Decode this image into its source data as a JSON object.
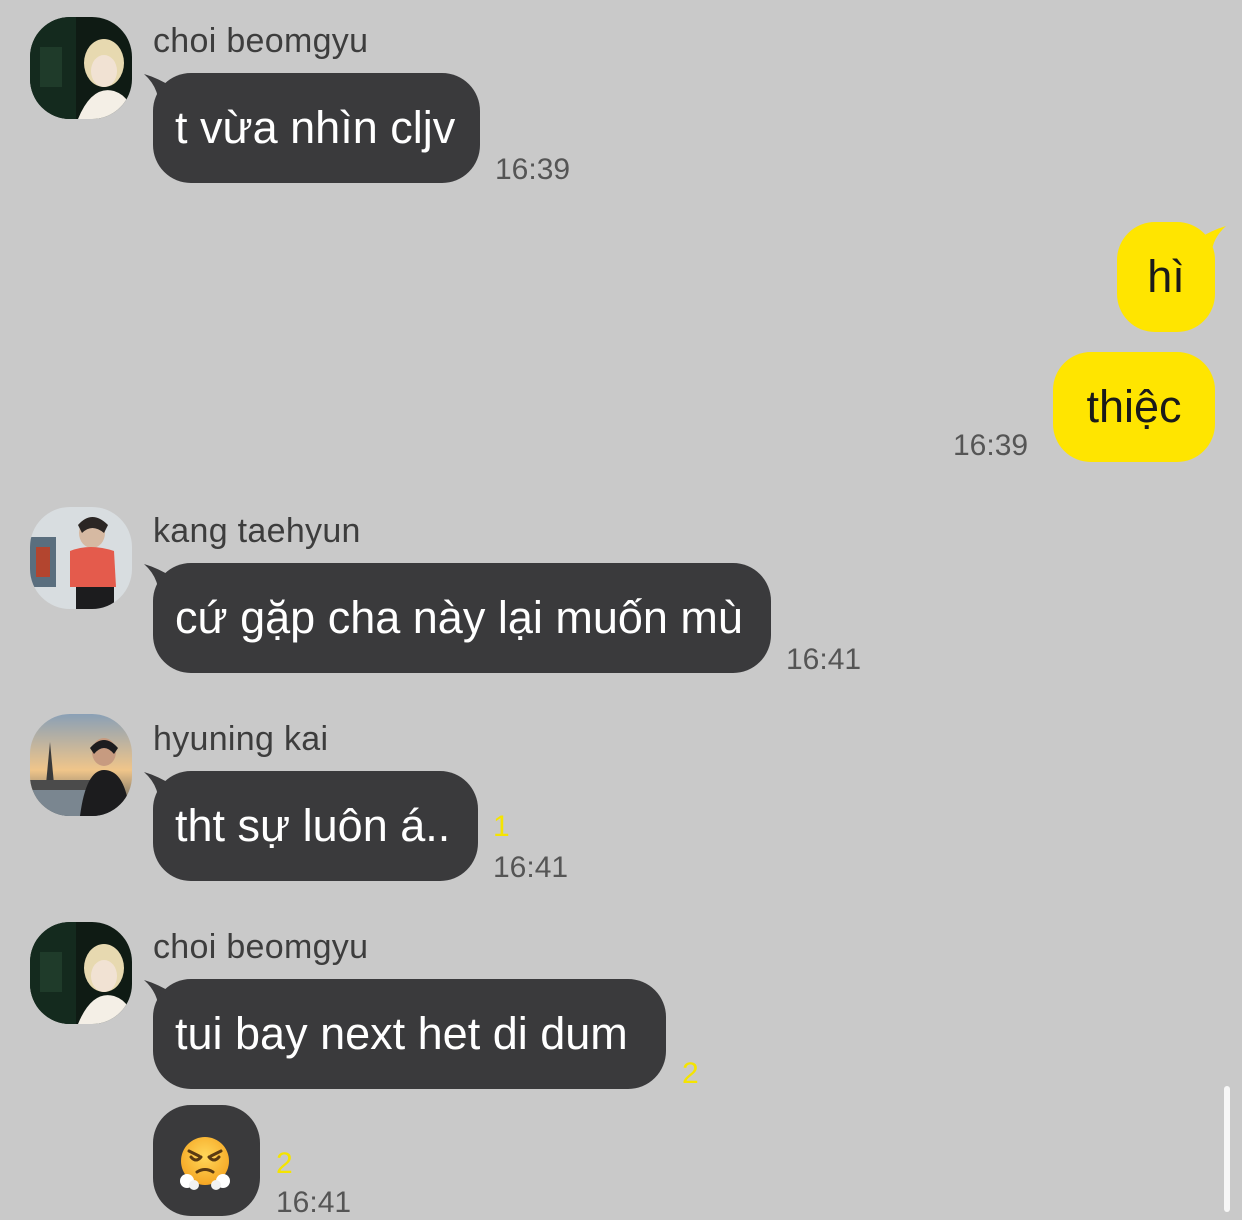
{
  "messages": [
    {
      "sender": "choi beomgyu",
      "text": "t vừa nhìn cljv",
      "time": "16:39"
    },
    {
      "text": "hì"
    },
    {
      "text": "thiệc",
      "time": "16:39"
    },
    {
      "sender": "kang taehyun",
      "text": "cứ gặp cha này lại muốn mù",
      "time": "16:41"
    },
    {
      "sender": "hyuning kai",
      "text": "tht sự luôn á..",
      "unread": "1",
      "time": "16:41"
    },
    {
      "sender": "choi beomgyu",
      "text": "tui bay next het di dum",
      "unread": "2"
    },
    {
      "emoji": "face-with-steam-from-nose",
      "unread": "2",
      "time": "16:41"
    }
  ],
  "colors": {
    "background": "#c9c9c9",
    "incoming_bubble": "#3a3a3c",
    "outgoing_bubble": "#ffe500",
    "unread_count": "#f5e400"
  }
}
